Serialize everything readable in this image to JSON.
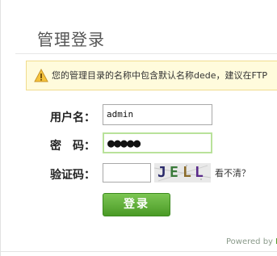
{
  "header": {
    "title": "管理登录"
  },
  "warning": {
    "icon": "warning-triangle-icon",
    "text": "您的管理目录的名称中包含默认名称dede，建议在FTP"
  },
  "form": {
    "username_label": "用户名：",
    "username_value": "admin",
    "password_label": "密　码：",
    "password_mask": "●●●●●",
    "captcha_label": "验证码：",
    "captcha_value": "",
    "captcha_chars": [
      "J",
      "E",
      "L",
      "L"
    ],
    "captcha_colors": [
      "#2a2a6a",
      "#3a7a3a",
      "#8a6a2a",
      "#5a2a8a"
    ],
    "cant_see": "看不清？",
    "login_button": "登录"
  },
  "footer": {
    "powered_by": "Powered by ",
    "brand": "D"
  }
}
